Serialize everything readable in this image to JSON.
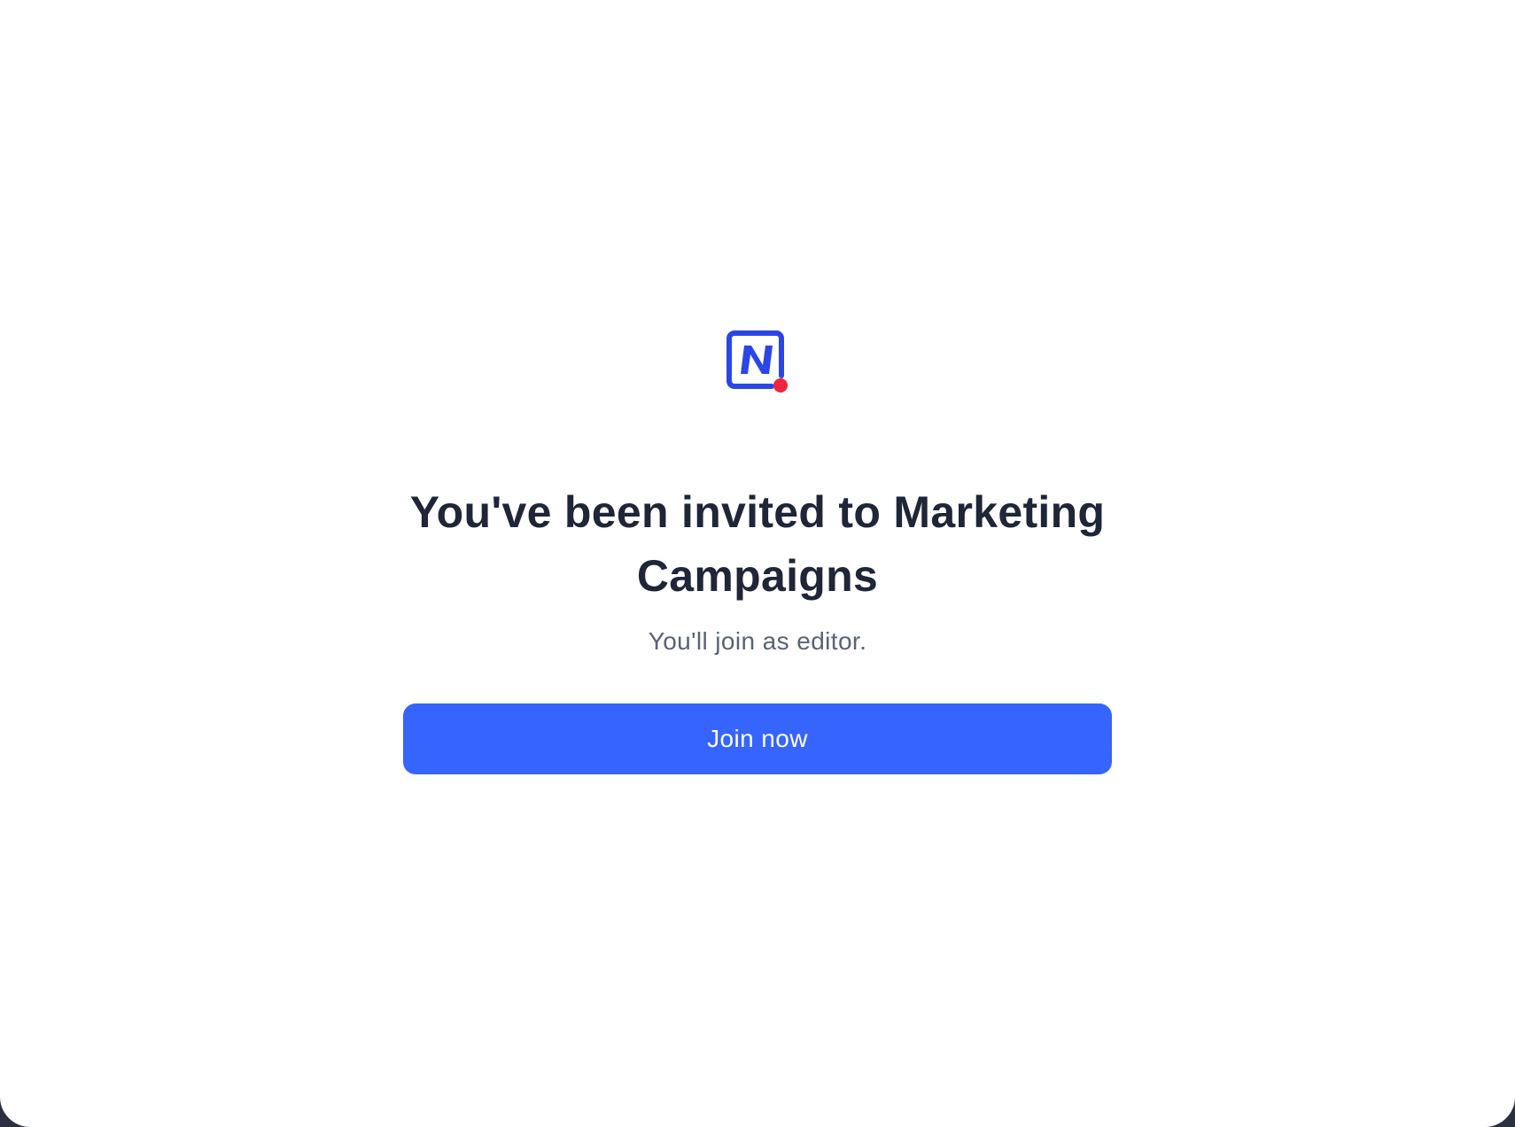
{
  "invite": {
    "title": "You've been invited to Marketing Campaigns",
    "subtitle": "You'll join as editor.",
    "join_label": "Join now"
  },
  "logo": {
    "icon": "n-logo-icon",
    "letter": "N",
    "frame_color": "#2a46e8",
    "dot_color": "#f0243c"
  },
  "colors": {
    "primary": "#3565fe",
    "heading": "#1e2638",
    "muted": "#5a6275",
    "background": "#ffffff"
  }
}
